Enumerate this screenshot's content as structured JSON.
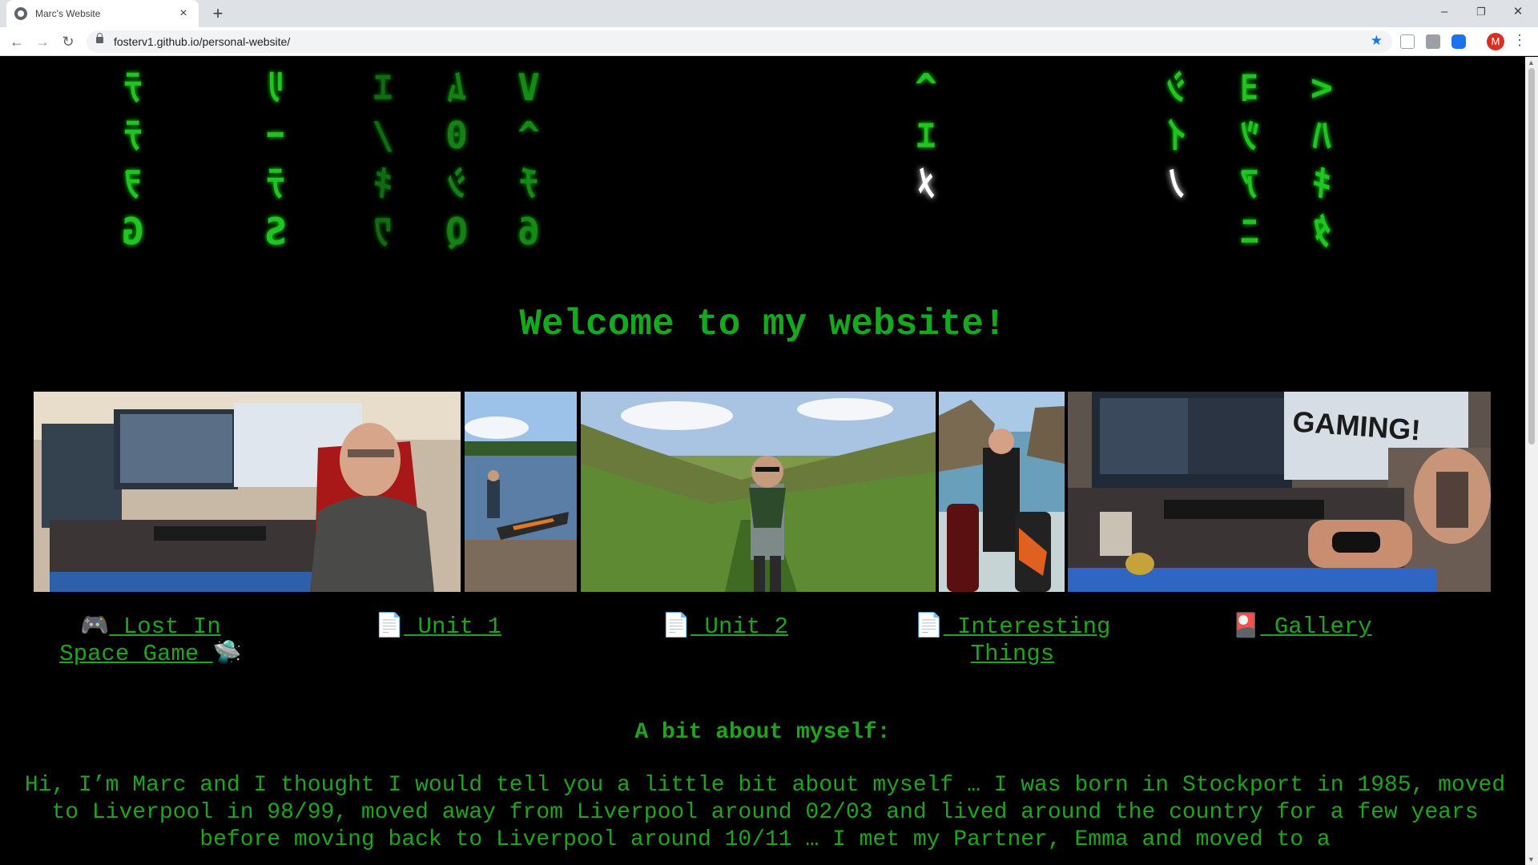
{
  "browser": {
    "tab_title": "Marc's Website",
    "tab_close": "×",
    "new_tab": "+",
    "window_controls": {
      "minimize": "–",
      "restore": "❐",
      "close": "✕"
    },
    "back": "←",
    "forward": "→",
    "reload": "↻",
    "url": "fosterv1.github.io/personal-website/",
    "bookmark_star": "★",
    "profile_initial": "M",
    "menu": "⋮"
  },
  "matrix_rain": {
    "color": "#22c322",
    "columns": [
      [
        "ﾃ",
        "ﾃ",
        "ｦ",
        "G"
      ],
      [
        "ﾘ",
        "ｰ",
        "ﾃ",
        "S"
      ],
      [
        "ｴ",
        "/",
        "ｷ",
        "ﾜ"
      ],
      [
        "ﾑ",
        "0",
        "ｼ",
        "Q"
      ],
      [
        "V",
        "^",
        "ﾁ",
        "6"
      ],
      [
        "^",
        "ｴ",
        "ﾒ"
      ],
      [
        "ｼ",
        "ｲ",
        "ﾉ"
      ],
      [
        "ﾖ",
        "ﾂ",
        "ｱ",
        "ﾆ"
      ],
      [
        "<",
        "ﾊ",
        "ｷ",
        "ﾀ"
      ]
    ]
  },
  "header": {
    "welcome": "Welcome to my website!",
    "color": "#15aa1d"
  },
  "photos": [
    {
      "subject": "man-at-desk-photo"
    },
    {
      "subject": "kayak-on-lake-photo"
    },
    {
      "subject": "hiker-in-valley-photo"
    },
    {
      "subject": "bodyboarder-on-beach-photo"
    },
    {
      "subject": "gaming-setup-photo",
      "sign_text": "GAMING!"
    }
  ],
  "nav": {
    "lost_in_space": {
      "icon": "🎮",
      "label": "Lost In Space Game",
      "trail_icon": "🛸"
    },
    "unit1": {
      "icon": "📄",
      "label": "Unit 1"
    },
    "unit2": {
      "icon": "📄",
      "label": "Unit 2"
    },
    "interesting": {
      "icon": "📄",
      "label": "Interesting Things"
    },
    "gallery": {
      "icon": "🎴",
      "label": "Gallery"
    }
  },
  "about": {
    "heading": "A bit about myself:",
    "text": "Hi, I’m Marc and I thought I would tell you a little bit about myself … I was born in Stockport in 1985, moved to Liverpool in 98/99, moved away from Liverpool around 02/03 and lived around the country for a few years before moving back to Liverpool around 10/11 … I met my Partner, Emma and moved to a"
  }
}
